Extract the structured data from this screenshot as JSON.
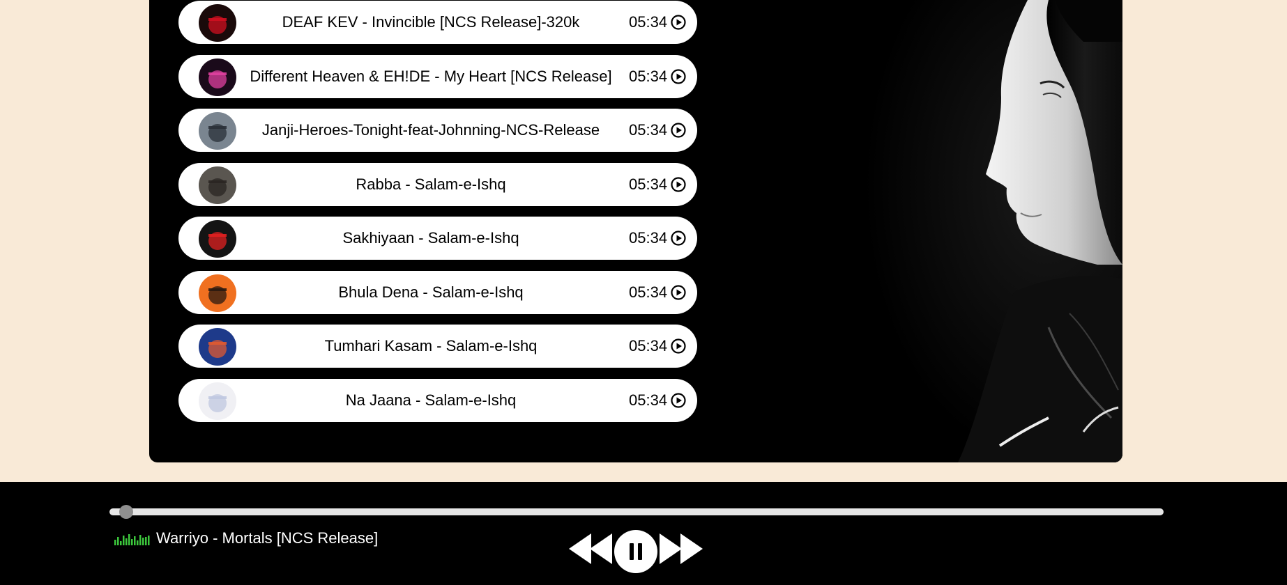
{
  "songs": [
    {
      "title": "DEAF KEV - Invincible [NCS Release]-320k",
      "duration": "05:34",
      "cover_icon": "album-cover-they-mad",
      "cover_colors": [
        "#1a0a0a",
        "#d01020"
      ]
    },
    {
      "title": "Different Heaven & EH!DE - My Heart [NCS Release]",
      "duration": "05:34",
      "cover_icon": "album-cover-pink-astronaut",
      "cover_colors": [
        "#1a0a1a",
        "#e040a0"
      ]
    },
    {
      "title": "Janji-Heroes-Tonight-feat-Johnning-NCS-Release",
      "duration": "05:34",
      "cover_icon": "album-cover-grey-figure",
      "cover_colors": [
        "#7a8590",
        "#2a3038"
      ]
    },
    {
      "title": "Rabba - Salam-e-Ishq",
      "duration": "05:34",
      "cover_icon": "album-cover-safety-dance",
      "cover_colors": [
        "#5a5650",
        "#2a2622"
      ]
    },
    {
      "title": "Sakhiyaan - Salam-e-Ishq",
      "duration": "05:34",
      "cover_icon": "album-cover-back-it-up",
      "cover_colors": [
        "#141414",
        "#e02020"
      ]
    },
    {
      "title": "Bhula Dena - Salam-e-Ishq",
      "duration": "05:34",
      "cover_icon": "album-cover-orange",
      "cover_colors": [
        "#f07020",
        "#2a1a10"
      ]
    },
    {
      "title": "Tumhari Kasam - Salam-e-Ishq",
      "duration": "05:34",
      "cover_icon": "album-cover-portrait",
      "cover_colors": [
        "#1e3a8a",
        "#e05a30"
      ]
    },
    {
      "title": "Na Jaana - Salam-e-Ishq",
      "duration": "05:34",
      "cover_icon": "album-cover-true-love",
      "cover_colors": [
        "#f0f0f4",
        "#c0c8e0"
      ]
    }
  ],
  "player": {
    "now_playing": "Warriyo - Mortals [NCS Release]",
    "progress": 0.016,
    "state": "playing",
    "eq_color": "#3cc83c"
  },
  "colors": {
    "page_bg": "#f9ead7",
    "panel_bg": "#000000",
    "row_bg": "#ffffff"
  }
}
